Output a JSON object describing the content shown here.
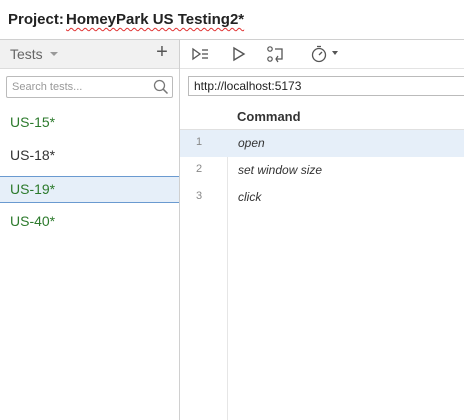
{
  "project": {
    "label": "Project:",
    "name": "HomeyPark US Testing2*"
  },
  "tests_panel": {
    "header_label": "Tests",
    "add_label": "+",
    "search_placeholder": "Search tests...",
    "items": [
      {
        "label": "US-15*",
        "color": "#2c7a2c",
        "selected": false
      },
      {
        "label": "US-18*",
        "color": "#333333",
        "selected": false
      },
      {
        "label": "US-19*",
        "color": "#2c7a2c",
        "selected": true
      },
      {
        "label": "US-40*",
        "color": "#2c7a2c",
        "selected": false
      }
    ]
  },
  "toolbar": {
    "buttons": [
      "run-all-icon",
      "run-icon",
      "record-icon",
      "speed-icon"
    ]
  },
  "base_url": "http://localhost:5173",
  "command_table": {
    "header": "Command",
    "rows": [
      {
        "num": "1",
        "command": "open",
        "selected": true
      },
      {
        "num": "2",
        "command": "set window size",
        "selected": false
      },
      {
        "num": "3",
        "command": "click",
        "selected": false
      }
    ]
  }
}
